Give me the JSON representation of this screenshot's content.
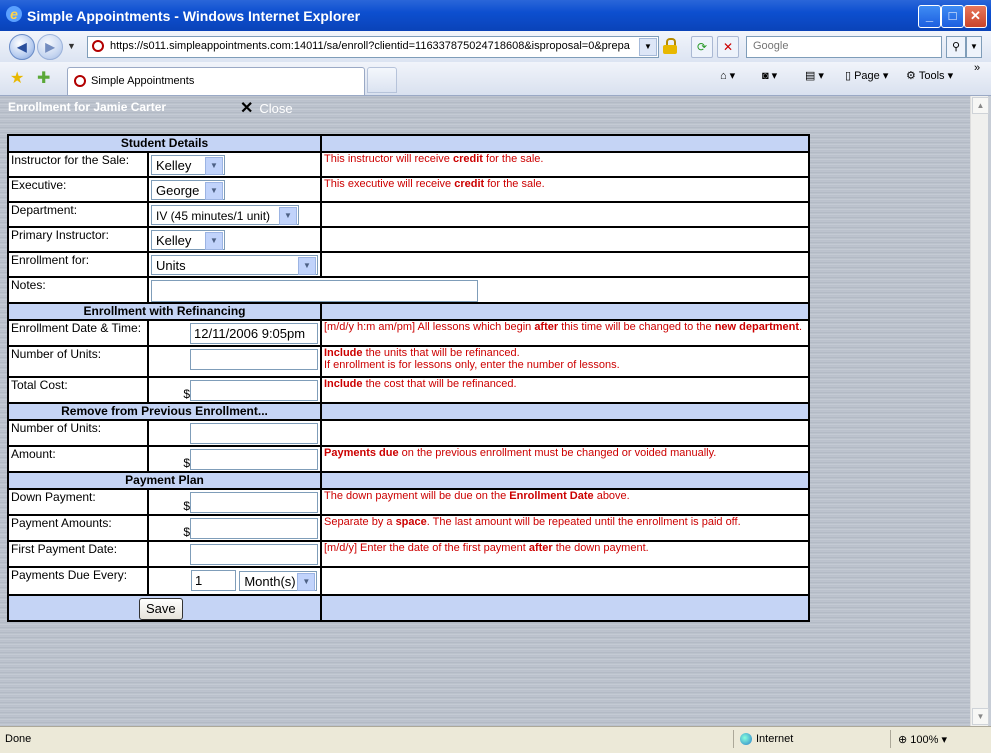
{
  "window": {
    "title": "Simple Appointments - Windows Internet Explorer"
  },
  "browser": {
    "url": "https://s011.simpleappointments.com:14011/sa/enroll?clientid=116337875024718608&isproposal=0&prepaid=",
    "search_placeholder": "Google",
    "tab_title": "Simple Appointments",
    "toolbar": {
      "page": "Page",
      "tools": "Tools"
    }
  },
  "page": {
    "title": "Enrollment for Jamie Carter",
    "close_label": "Close"
  },
  "sections": {
    "student": "Student Details",
    "refinance": "Enrollment with Refinancing",
    "remove": "Remove from Previous Enrollment...",
    "payment": "Payment Plan"
  },
  "fields": {
    "instructor_sale": {
      "label": "Instructor for the Sale:",
      "value": "Kelley"
    },
    "executive": {
      "label": "Executive:",
      "value": "George"
    },
    "department": {
      "label": "Department:",
      "value": "IV (45 minutes/1 unit)"
    },
    "primary_instructor": {
      "label": "Primary Instructor:",
      "value": "Kelley"
    },
    "enrollment_for": {
      "label": "Enrollment for:",
      "value": "Units"
    },
    "notes": {
      "label": "Notes:",
      "value": ""
    },
    "enroll_date": {
      "label": "Enrollment Date & Time:",
      "value": "12/11/2006 9:05pm"
    },
    "num_units": {
      "label": "Number of Units:",
      "value": ""
    },
    "total_cost": {
      "label": "Total Cost:",
      "value": ""
    },
    "remove_units": {
      "label": "Number of Units:",
      "value": ""
    },
    "remove_amount": {
      "label": "Amount:",
      "value": ""
    },
    "down_payment": {
      "label": "Down Payment:",
      "value": ""
    },
    "payment_amounts": {
      "label": "Payment Amounts:",
      "value": ""
    },
    "first_payment_date": {
      "label": "First Payment Date:",
      "value": ""
    },
    "payments_due": {
      "label": "Payments Due Every:",
      "value": "1",
      "unit": "Month(s)"
    }
  },
  "currency_symbol": "$",
  "help": {
    "instructor_sale": {
      "a": "This instructor will receive ",
      "b": "credit",
      "c": " for the sale."
    },
    "executive": {
      "a": "This executive will receive ",
      "b": "credit",
      "c": " for the sale."
    },
    "enroll_date": {
      "a": "[m/d/y h:m am/pm] All lessons which begin ",
      "b": "after",
      "c": " this time will be changed to the ",
      "d": "new department",
      "e": "."
    },
    "num_units": {
      "a": "Include",
      "b": " the units that will be refinanced.",
      "line2": "If enrollment is for lessons only, enter the number of lessons."
    },
    "total_cost": {
      "a": "Include",
      "b": " the cost that will be refinanced."
    },
    "remove_amount": {
      "a": "Payments due",
      "b": " on the previous enrollment must be changed or voided manually."
    },
    "down_payment": {
      "a": "The down payment will be due on the ",
      "b": "Enrollment Date",
      "c": " above."
    },
    "payment_amounts": {
      "a": "Separate by a ",
      "b": "space",
      "c": ". The last amount will be repeated until the enrollment is paid off."
    },
    "first_payment_date": {
      "a": "[m/d/y] Enter the date of the first payment ",
      "b": "after",
      "c": " the down payment."
    }
  },
  "save_label": "Save",
  "status": {
    "left": "Done",
    "zone": "Internet",
    "zoom": "100%"
  }
}
